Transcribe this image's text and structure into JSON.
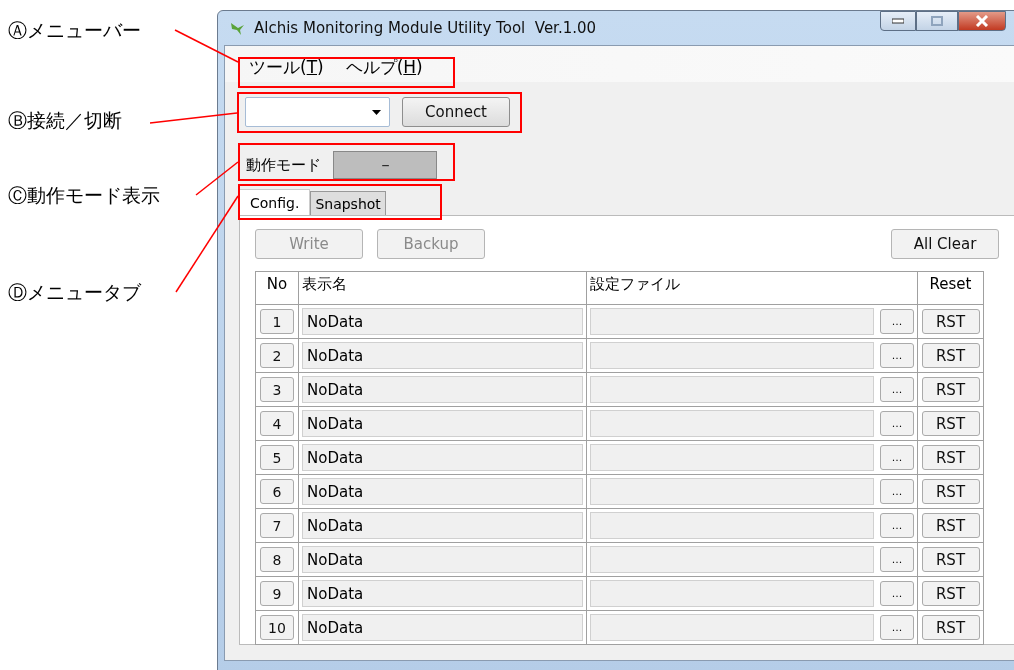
{
  "annotations": [
    {
      "text": "Ⓐメニューバー"
    },
    {
      "text": "Ⓑ接続／切断"
    },
    {
      "text": "Ⓒ動作モード表示"
    },
    {
      "text": "Ⓓメニュータブ"
    }
  ],
  "window": {
    "title": "Alchis Monitoring Module Utility Tool  Ver.1.00"
  },
  "menu": [
    {
      "parts": [
        "ツール(",
        "T",
        ")"
      ]
    },
    {
      "parts": [
        "ヘルプ(",
        "H",
        ")"
      ]
    }
  ],
  "connection": {
    "button": "Connect"
  },
  "mode": {
    "label": "動作モード",
    "value": "－"
  },
  "tabs": [
    {
      "label": "Config.",
      "selected": true
    },
    {
      "label": "Snapshot",
      "selected": false
    }
  ],
  "toolbar": [
    {
      "label": "Write",
      "disabled": true
    },
    {
      "label": "Backup",
      "disabled": true
    },
    {
      "label": "All Clear",
      "disabled": false
    }
  ],
  "table": {
    "columns": [
      "No",
      "表示名",
      "設定ファイル",
      "Reset"
    ],
    "rows": [
      {
        "no": "1",
        "name": "NoData",
        "browse": "...",
        "reset": "RST"
      },
      {
        "no": "2",
        "name": "NoData",
        "browse": "...",
        "reset": "RST"
      },
      {
        "no": "3",
        "name": "NoData",
        "browse": "...",
        "reset": "RST"
      },
      {
        "no": "4",
        "name": "NoData",
        "browse": "...",
        "reset": "RST"
      },
      {
        "no": "5",
        "name": "NoData",
        "browse": "...",
        "reset": "RST"
      },
      {
        "no": "6",
        "name": "NoData",
        "browse": "...",
        "reset": "RST"
      },
      {
        "no": "7",
        "name": "NoData",
        "browse": "...",
        "reset": "RST"
      },
      {
        "no": "8",
        "name": "NoData",
        "browse": "...",
        "reset": "RST"
      },
      {
        "no": "9",
        "name": "NoData",
        "browse": "...",
        "reset": "RST"
      },
      {
        "no": "10",
        "name": "NoData",
        "browse": "...",
        "reset": "RST"
      }
    ]
  }
}
